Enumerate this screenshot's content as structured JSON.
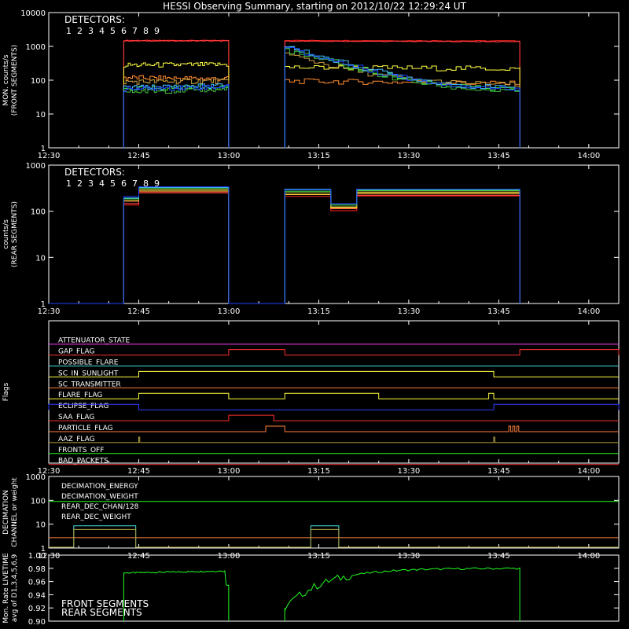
{
  "title": "HESSI Observing Summary, starting on 2012/10/22 12:29:24 UT",
  "colors": {
    "det": [
      "#ff2020",
      "#ff4040",
      "#ff8c30",
      "#ffff40",
      "#c8a040",
      "#40e040",
      "#40c040",
      "#40c0ff",
      "#2040ff"
    ],
    "magenta": "#ff40ff",
    "red": "#ff3030",
    "cyan": "#40e0e0",
    "yellow": "#ffff40",
    "orange": "#ff8040",
    "blue": "#3040ff",
    "olive": "#b0a040",
    "green": "#20ff20"
  },
  "chart_data": [
    {
      "type": "line",
      "id": "front",
      "ylabel": "MON. counts/s\n(FRONT SEGMENTS)",
      "yscale": "log",
      "ylim": [
        1,
        10000
      ],
      "yticks": [
        "1",
        "10",
        "100",
        "1000",
        "10000"
      ],
      "xlim": [
        0,
        5700
      ],
      "xticks": [
        {
          "t": 0,
          "label": "12:30"
        },
        {
          "t": 900,
          "label": "12:45"
        },
        {
          "t": 1800,
          "label": "13:00"
        },
        {
          "t": 2700,
          "label": "13:15"
        },
        {
          "t": 3600,
          "label": "13:30"
        },
        {
          "t": 4500,
          "label": "13:45"
        },
        {
          "t": 5400,
          "label": "14:00"
        }
      ],
      "legend_title": "DETECTORS:",
      "legend_nums": [
        "1",
        "2",
        "3",
        "4",
        "5",
        "6",
        "7",
        "8",
        "9"
      ],
      "legend_placement": "top-left",
      "segments": [
        [
          750,
          1800
        ],
        [
          2360,
          4710
        ]
      ],
      "series": [
        {
          "values_seg1": [
            1500,
            1500
          ],
          "values_seg2": [
            1500,
            1450
          ]
        },
        {
          "values_seg1": [
            1450,
            1450
          ],
          "values_seg2": [
            1420,
            1380
          ]
        },
        {
          "values_seg1": [
            120,
            110
          ],
          "values_seg2": [
            95,
            80
          ]
        },
        {
          "values_seg1": [
            280,
            290
          ],
          "values_seg2": [
            240,
            220
          ]
        },
        {
          "values_seg1": [
            90,
            95
          ],
          "values_seg2": [
            600,
            70
          ]
        },
        {
          "values_seg1": [
            55,
            65
          ],
          "values_seg2": [
            900,
            45
          ]
        },
        {
          "values_seg1": [
            45,
            55
          ],
          "values_seg2": [
            800,
            40
          ]
        },
        {
          "values_seg1": [
            60,
            70
          ],
          "values_seg2": [
            1000,
            50
          ]
        },
        {
          "values_seg1": [
            55,
            65
          ],
          "values_seg2": [
            950,
            48
          ]
        }
      ]
    },
    {
      "type": "line",
      "id": "rear",
      "ylabel": "counts/s\n(REAR SEGMENTS)",
      "yscale": "log",
      "ylim": [
        1,
        1000
      ],
      "yticks": [
        "1",
        "10",
        "100",
        "1000"
      ],
      "xlim": [
        0,
        5700
      ],
      "xticks": [
        {
          "t": 0,
          "label": "12:30"
        },
        {
          "t": 900,
          "label": "12:45"
        },
        {
          "t": 1800,
          "label": "13:00"
        },
        {
          "t": 2700,
          "label": "13:15"
        },
        {
          "t": 3600,
          "label": "13:30"
        },
        {
          "t": 4500,
          "label": "13:45"
        },
        {
          "t": 5400,
          "label": "14:00"
        }
      ],
      "legend_title": "DETECTORS:",
      "legend_nums": [
        "1",
        "2",
        "3",
        "4",
        "5",
        "6",
        "7",
        "8",
        "9"
      ],
      "legend_placement": "top-left",
      "steps": [
        {
          "t": 750,
          "v": 180
        },
        {
          "t": 900,
          "v": 300
        },
        {
          "t": 1800,
          "v": 0
        },
        {
          "t": 2360,
          "v": 260
        },
        {
          "t": 2820,
          "v": 130
        },
        {
          "t": 3080,
          "v": 270
        },
        {
          "t": 4710,
          "v": 0
        }
      ]
    },
    {
      "type": "flags",
      "id": "flags",
      "ylabel": "Flags",
      "xlim": [
        0,
        5700
      ],
      "xticks": [
        {
          "t": 0,
          "label": "12:30"
        },
        {
          "t": 900,
          "label": "12:45"
        },
        {
          "t": 1800,
          "label": "13:00"
        },
        {
          "t": 2700,
          "label": "13:15"
        },
        {
          "t": 3600,
          "label": "13:30"
        },
        {
          "t": 4500,
          "label": "13:45"
        },
        {
          "t": 5400,
          "label": "14:00"
        }
      ],
      "flags": [
        {
          "name": "ATTENUATOR_STATE",
          "color": "magenta",
          "high": []
        },
        {
          "name": "GAP_FLAG",
          "color": "red",
          "high": [
            [
              1800,
              2360
            ],
            [
              4710,
              5700
            ]
          ]
        },
        {
          "name": "POSSIBLE_FLARE",
          "color": "cyan",
          "high": []
        },
        {
          "name": "SC_IN_SUNLIGHT",
          "color": "yellow",
          "high": [
            [
              900,
              4450
            ]
          ]
        },
        {
          "name": "SC_TRANSMITTER",
          "color": "orange",
          "high": []
        },
        {
          "name": "FLARE_FLAG",
          "color": "yellow",
          "high": [
            [
              900,
              1800
            ],
            [
              2360,
              3300
            ],
            [
              4400,
              4450
            ]
          ]
        },
        {
          "name": "ECLIPSE_FLAG",
          "color": "blue",
          "high": [
            [
              0,
              900
            ],
            [
              4450,
              5700
            ]
          ]
        },
        {
          "name": "SAA_FLAG",
          "color": "red",
          "high": [
            [
              1800,
              2250
            ]
          ]
        },
        {
          "name": "PARTICLE_FLAG",
          "color": "orange",
          "high": [
            [
              2170,
              2360
            ],
            [
              4600,
              4620
            ],
            [
              4640,
              4660
            ],
            [
              4680,
              4700
            ]
          ]
        },
        {
          "name": "AAZ_FLAG",
          "color": "olive",
          "high": [
            [
              900,
              910
            ],
            [
              4450,
              4460
            ]
          ]
        },
        {
          "name": "FRONTS_OFF",
          "color": "green",
          "high": []
        },
        {
          "name": "BAD_PACKETS",
          "color": "red",
          "high": []
        }
      ]
    },
    {
      "type": "line",
      "id": "decimation",
      "ylabel": "DECIMATION\nCHANNEL or weight",
      "yscale": "log",
      "ylim": [
        1,
        1000
      ],
      "yticks": [
        "1",
        "10",
        "100",
        "1000"
      ],
      "xlim": [
        0,
        5700
      ],
      "xticks": [
        {
          "t": 0,
          "label": "12:30"
        },
        {
          "t": 900,
          "label": "12:45"
        },
        {
          "t": 1800,
          "label": "13:00"
        },
        {
          "t": 2700,
          "label": "13:15"
        },
        {
          "t": 3600,
          "label": "13:30"
        },
        {
          "t": 4500,
          "label": "13:45"
        },
        {
          "t": 5400,
          "label": "14:00"
        }
      ],
      "legend_placement": "top-left",
      "series": [
        {
          "name": "DECIMATION_ENERGY",
          "color": "green",
          "const": 90
        },
        {
          "name": "DECIMATION_WEIGHT",
          "color": "orange",
          "const": 2.7
        },
        {
          "name": "REAR_DEC_CHAN/128",
          "color": "cyan",
          "pulses": [
            [
              250,
              870,
              8.5
            ],
            [
              2620,
              2900,
              8.5
            ]
          ]
        },
        {
          "name": "REAR_DEC_WEIGHT",
          "color": "olive",
          "pulses": [
            [
              250,
              870,
              6
            ],
            [
              2620,
              2900,
              6
            ]
          ]
        }
      ]
    },
    {
      "type": "line",
      "id": "livetime",
      "ylabel": "Mon. Rate LIVETIME\navg of D1,3,4,5,6,9",
      "yscale": "linear",
      "ylim": [
        0.9,
        1.0
      ],
      "yticks": [
        "0.90",
        "0.92",
        "0.94",
        "0.96",
        "0.98",
        "1.00"
      ],
      "xlim": [
        0,
        5700
      ],
      "legend_placement": "bottom-left",
      "series": [
        {
          "name": "FRONT SEGMENTS",
          "color": "green",
          "seg1": [
            0.973,
            0.976
          ],
          "seg2_start": 0.92,
          "seg2_end": 0.98
        },
        {
          "name": "REAR SEGMENTS",
          "color": "green"
        }
      ],
      "segments": [
        [
          750,
          1800
        ],
        [
          2360,
          4710
        ]
      ]
    }
  ]
}
